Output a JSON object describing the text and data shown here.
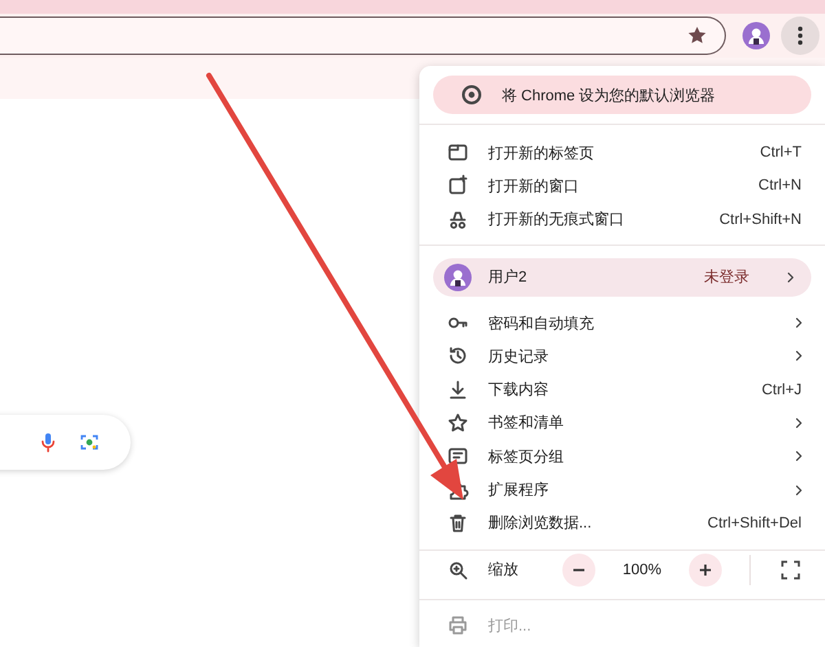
{
  "menu": {
    "banner": "将 Chrome 设为您的默认浏览器",
    "window_items": [
      {
        "label": "打开新的标签页",
        "shortcut": "Ctrl+T",
        "has_submenu": false
      },
      {
        "label": "打开新的窗口",
        "shortcut": "Ctrl+N",
        "has_submenu": false
      },
      {
        "label": "打开新的无痕式窗口",
        "shortcut": "Ctrl+Shift+N",
        "has_submenu": false
      }
    ],
    "profile": {
      "name": "用户2",
      "status": "未登录",
      "has_submenu": true
    },
    "items": [
      {
        "label": "密码和自动填充",
        "has_submenu": true
      },
      {
        "label": "历史记录",
        "has_submenu": true
      },
      {
        "label": "下载内容",
        "shortcut": "Ctrl+J",
        "has_submenu": false
      },
      {
        "label": "书签和清单",
        "has_submenu": true
      },
      {
        "label": "标签页分组",
        "has_submenu": true
      },
      {
        "label": "扩展程序",
        "has_submenu": true
      },
      {
        "label": "删除浏览数据...",
        "shortcut": "Ctrl+Shift+Del",
        "has_submenu": false
      }
    ],
    "zoom": {
      "label": "缩放",
      "value": "100%"
    },
    "print": {
      "label": "打印..."
    }
  }
}
